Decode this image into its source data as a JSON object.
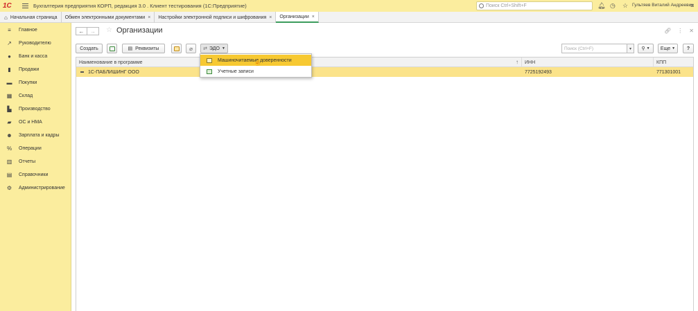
{
  "titlebar": {
    "logo": "1С",
    "title": "Бухгалтерия предприятия КОРП, редакция 3.0 . Клиент тестирования (1С:Предприятие)",
    "search_placeholder": "Поиск Ctrl+Shift+F",
    "user": "Гультяев Виталий Андреевич",
    "icons": [
      "bell-icon",
      "history-icon",
      "star-icon",
      "menu-icon"
    ]
  },
  "tabs": [
    {
      "label": "Начальная страница"
    },
    {
      "label": "Обмен электронными документами"
    },
    {
      "label": "Настройки электронной подписи и шифрования"
    },
    {
      "label": "Организации"
    }
  ],
  "sidebar": {
    "items": [
      {
        "label": "Главное",
        "icon": "≡"
      },
      {
        "label": "Руководителю",
        "icon": "↗"
      },
      {
        "label": "Банк и касса",
        "icon": "●"
      },
      {
        "label": "Продажи",
        "icon": "▮"
      },
      {
        "label": "Покупки",
        "icon": "▬"
      },
      {
        "label": "Склад",
        "icon": "▦"
      },
      {
        "label": "Производство",
        "icon": "▙"
      },
      {
        "label": "ОС и НМА",
        "icon": "▰"
      },
      {
        "label": "Зарплата и кадры",
        "icon": "☻"
      },
      {
        "label": "Операции",
        "icon": "%"
      },
      {
        "label": "Отчеты",
        "icon": "▥"
      },
      {
        "label": "Справочники",
        "icon": "▤"
      },
      {
        "label": "Администрирование",
        "icon": "⚙"
      }
    ]
  },
  "page": {
    "title": "Организации"
  },
  "toolbar": {
    "create": "Создать",
    "requisites": "Реквизиты",
    "edo": "ЭДО",
    "search_placeholder": "Поиск (Ctrl+F)",
    "more": "Еще",
    "help": "?"
  },
  "table": {
    "columns": [
      "Наименование в программе",
      "ИНН",
      "КПП"
    ],
    "rows": [
      [
        "1С-ПАБЛИШИНГ ООО",
        "7725192493",
        "771301001"
      ]
    ]
  },
  "edo_menu": {
    "items": [
      {
        "label": "Машиночитаемые доверенности"
      },
      {
        "label": "Учетные записи"
      }
    ]
  },
  "colors": {
    "accent": "#fbed9e",
    "row_selected": "#fbe38a",
    "menu_highlight": "#f7c932",
    "active_tab": "#3b9b5c"
  }
}
